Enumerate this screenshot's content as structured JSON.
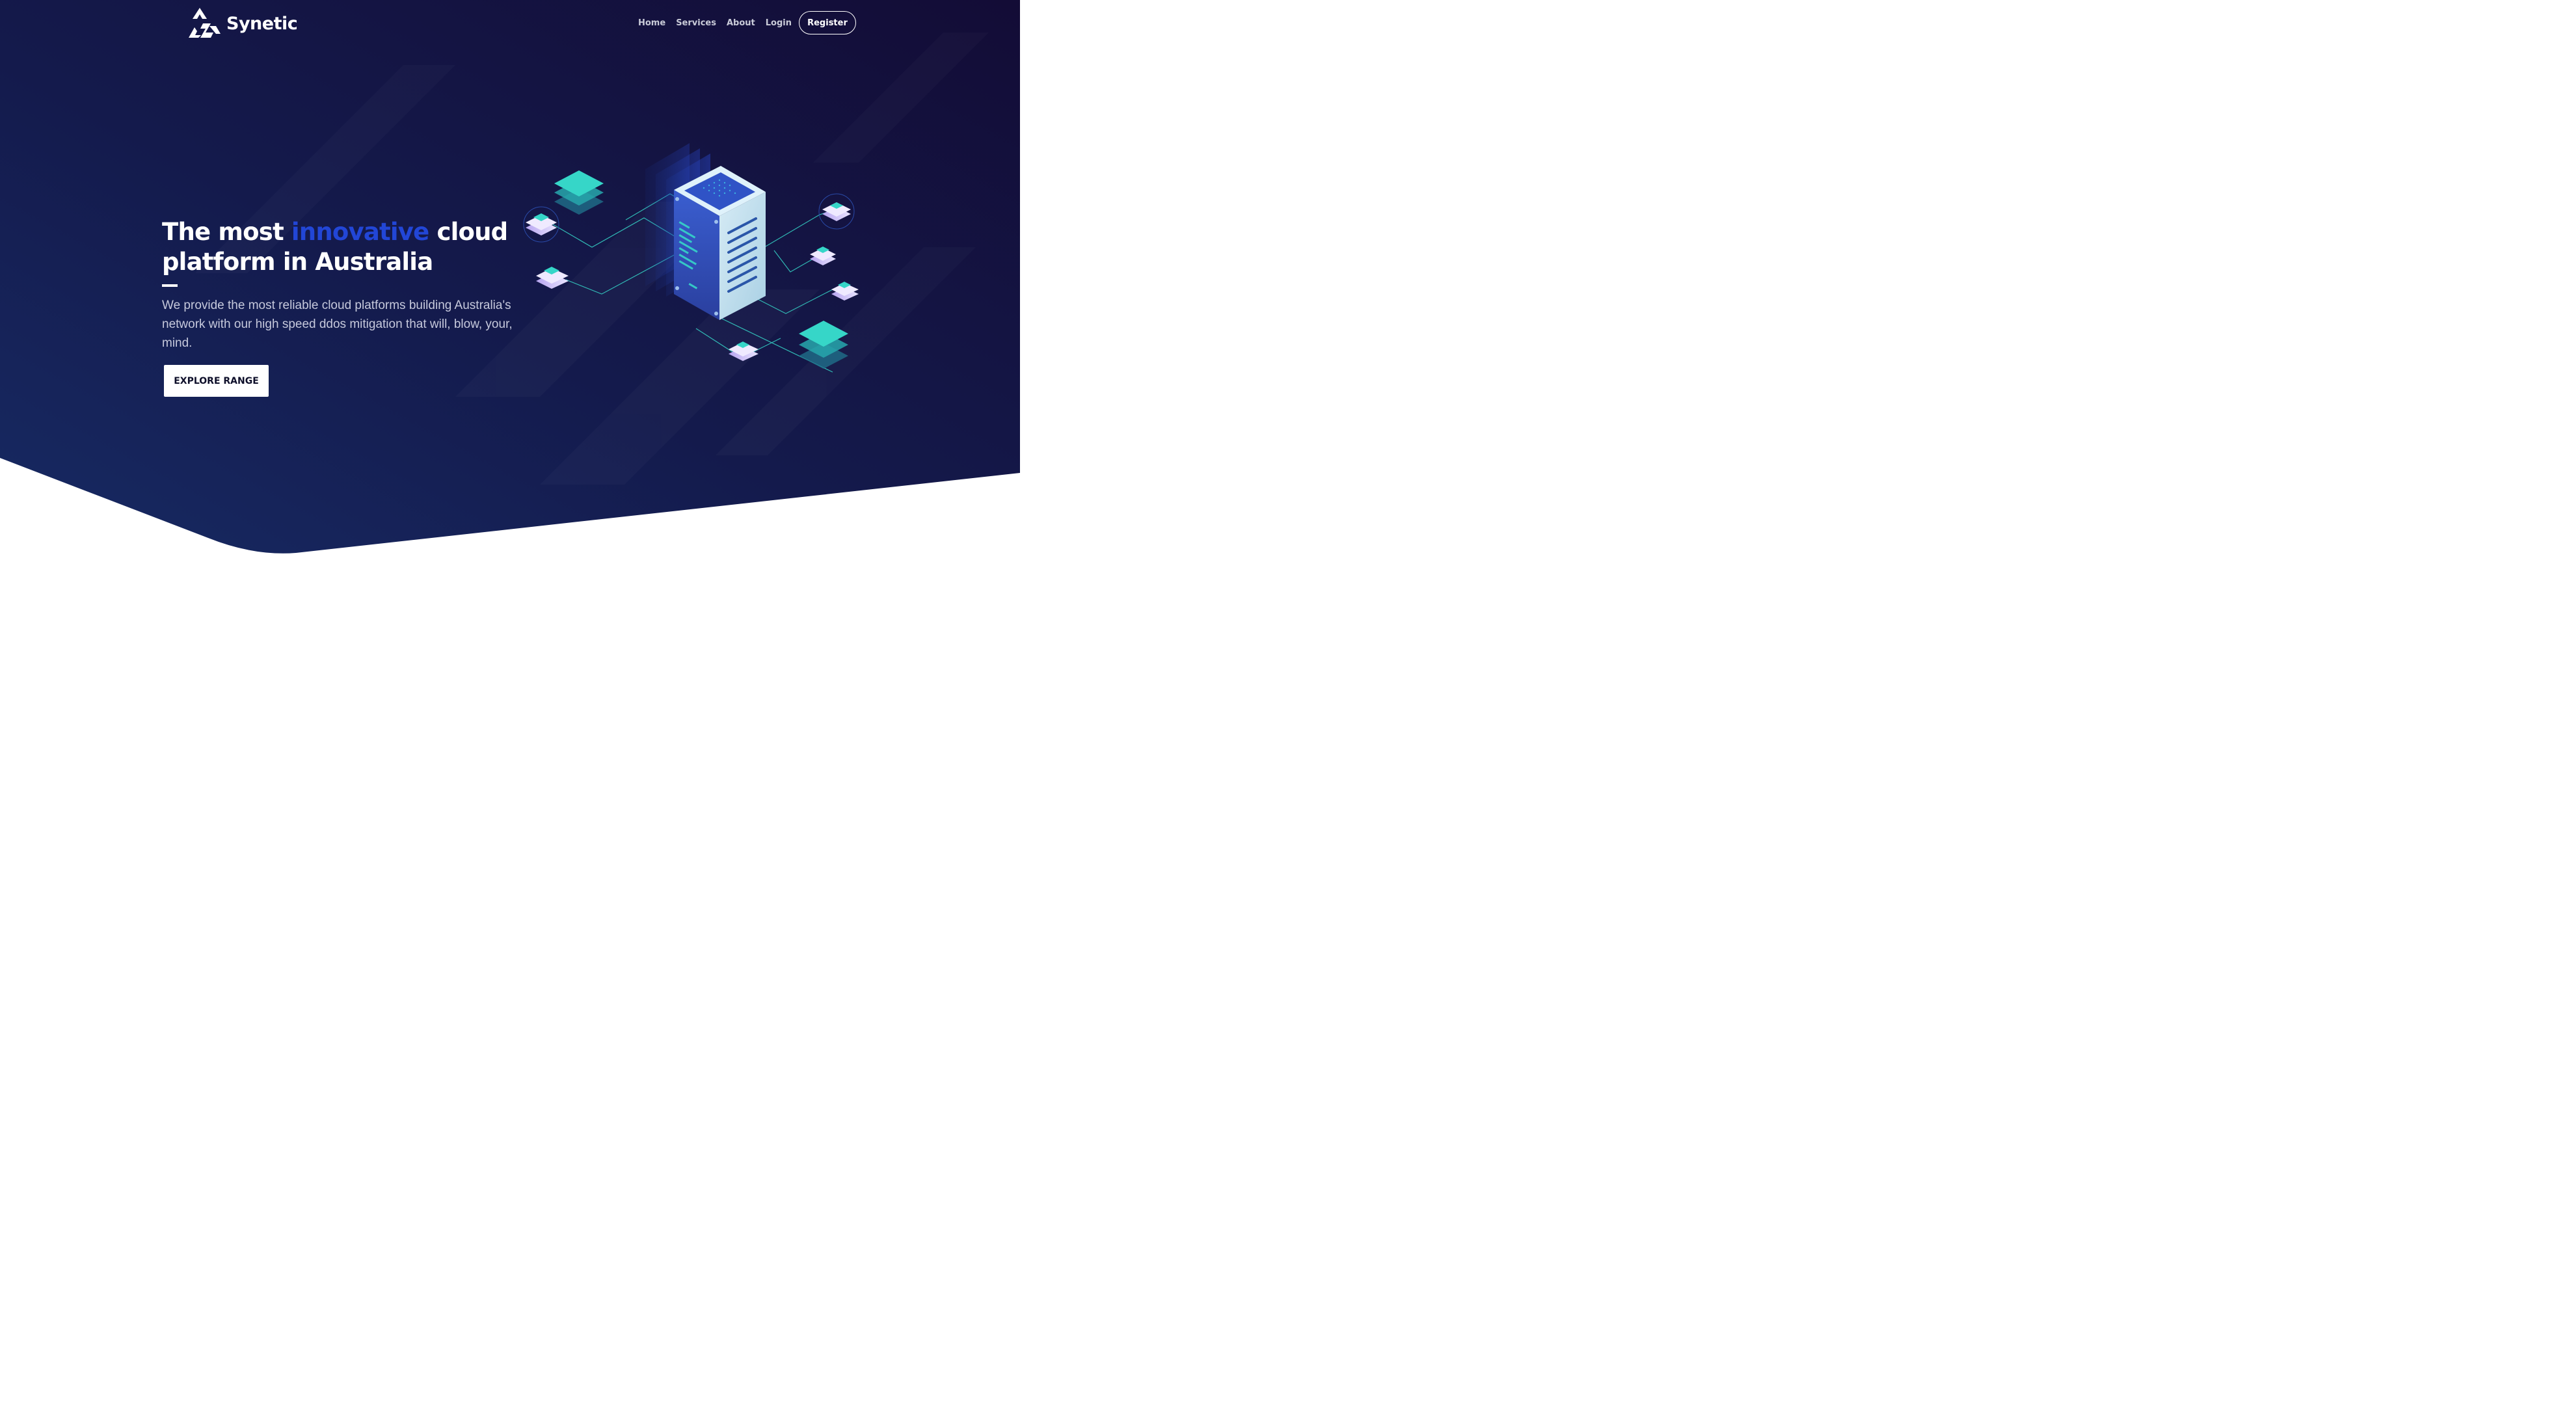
{
  "brand": {
    "name": "Synetic",
    "logo_icon": "triangle-logo-icon"
  },
  "nav": {
    "items": [
      {
        "label": "Home"
      },
      {
        "label": "Services"
      },
      {
        "label": "About"
      },
      {
        "label": "Login"
      }
    ],
    "register_label": "Register"
  },
  "hero": {
    "title_before": "The most ",
    "title_accent": "innovative",
    "title_after": " cloud platform in Australia",
    "description": "We provide the most reliable cloud platforms building Australia's network with our high speed ddos mitigation that will, blow, your, mind.",
    "cta_label": "EXPLORE RANGE"
  },
  "colors": {
    "background_dark": "#13133a",
    "background_navy": "#16235a",
    "accent_blue": "#2246d6",
    "teal": "#36d6c8",
    "white": "#ffffff"
  }
}
